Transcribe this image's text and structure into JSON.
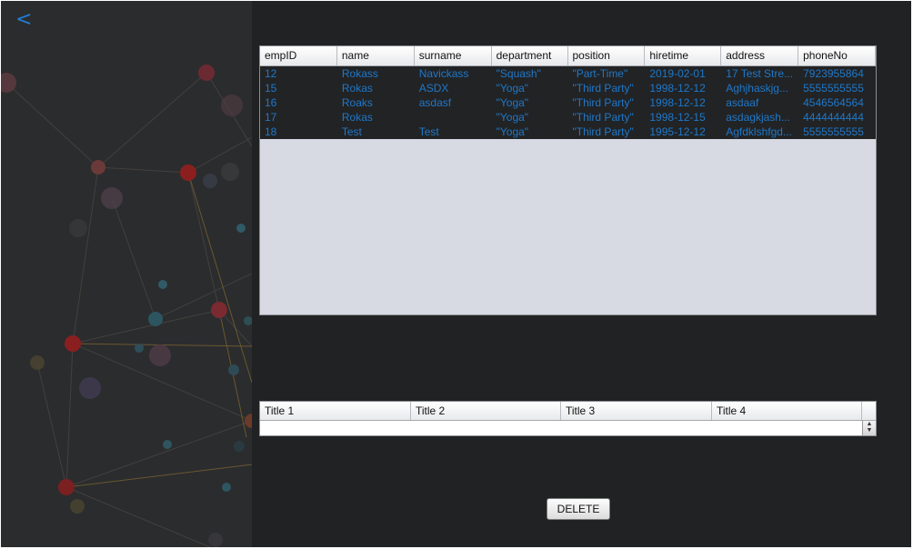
{
  "navigation": {
    "back_label": "<"
  },
  "employee_table": {
    "columns": [
      "empID",
      "name",
      "surname",
      "department",
      "position",
      "hiretime",
      "address",
      "phoneNo"
    ],
    "rows": [
      [
        "12",
        "Rokass",
        "Navickass",
        "\"Squash\"",
        "\"Part-Time\"",
        "2019-02-01",
        "17 Test Stre...",
        "7923955864"
      ],
      [
        "15",
        "Rokas",
        "ASDX",
        "\"Yoga\"",
        "\"Third Party\"",
        "1998-12-12",
        "Aghjhaskjg...",
        "5555555555"
      ],
      [
        "16",
        "Roaks",
        "asdasf",
        "\"Yoga\"",
        "\"Third Party\"",
        "1998-12-12",
        "asdaaf",
        "4546564564"
      ],
      [
        "17",
        "Rokas",
        "",
        "\"Yoga\"",
        "\"Third Party\"",
        "1998-12-15",
        "asdagkjash...",
        "4444444444"
      ],
      [
        "18",
        "Test",
        "Test",
        "\"Yoga\"",
        "\"Third Party\"",
        "1995-12-12",
        "Agfdklshfgd...",
        "5555555555"
      ]
    ]
  },
  "second_table": {
    "columns": [
      "Title 1",
      "Title 2",
      "Title 3",
      "Title 4",
      ""
    ]
  },
  "actions": {
    "delete_label": "DELETE"
  },
  "colors": {
    "window_background": "#212224",
    "side_panel": "#2b2c2e",
    "accent_blue": "#1f7fd6",
    "row_text": "#1f78c8",
    "node_red": "#8b1f1f"
  },
  "icons": {
    "back": "chevron-left-icon",
    "spinner": "spinner-arrows-icon"
  }
}
